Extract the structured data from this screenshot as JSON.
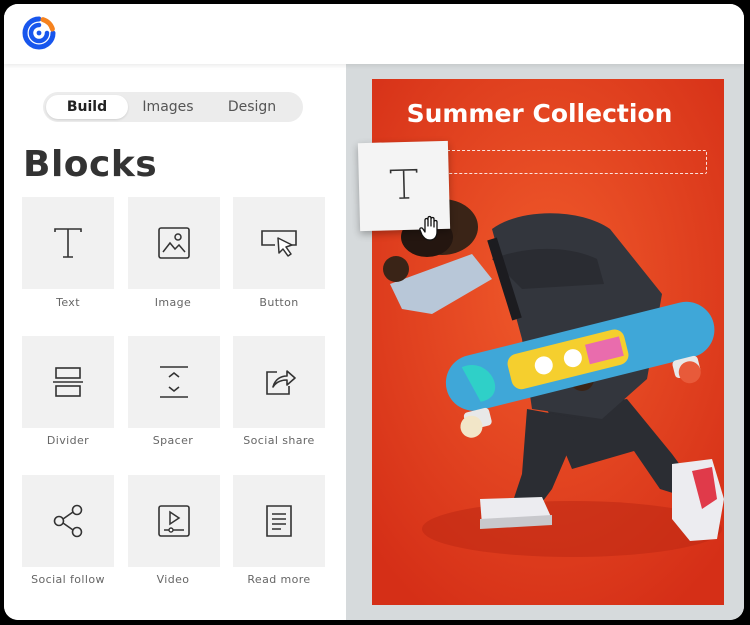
{
  "brand": {
    "logo_icon": "constant-contact-logo-icon",
    "accent": "#1856ed",
    "accent2": "#f5821f"
  },
  "sidebar": {
    "tabs": [
      {
        "label": "Build",
        "active": true
      },
      {
        "label": "Images",
        "active": false
      },
      {
        "label": "Design",
        "active": false
      }
    ],
    "heading": "Blocks",
    "blocks": [
      {
        "label": "Text",
        "icon": "text-icon"
      },
      {
        "label": "Image",
        "icon": "image-icon"
      },
      {
        "label": "Button",
        "icon": "button-cursor-icon"
      },
      {
        "label": "Divider",
        "icon": "divider-icon"
      },
      {
        "label": "Spacer",
        "icon": "spacer-icon"
      },
      {
        "label": "Social share",
        "icon": "share-icon"
      },
      {
        "label": "Social follow",
        "icon": "social-follow-icon"
      },
      {
        "label": "Video",
        "icon": "video-icon"
      },
      {
        "label": "Read more",
        "icon": "document-icon"
      }
    ]
  },
  "canvas": {
    "headline": "Summer Collection",
    "background_color": "#e43b1d",
    "dragging_block": "text-icon",
    "cursor": "grab-hand-icon"
  }
}
